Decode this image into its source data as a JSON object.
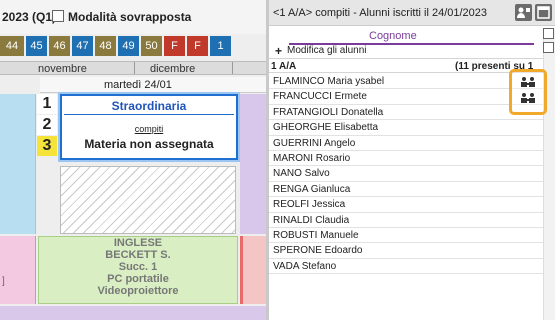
{
  "left": {
    "period_label": "2023 (Q1)",
    "toggle_label": "Modalità sovrapposta",
    "weeks": [
      {
        "label": "44",
        "bg": "#8b7a3e"
      },
      {
        "label": "45",
        "bg": "#1f6fb3"
      },
      {
        "label": "46",
        "bg": "#8b7a3e"
      },
      {
        "label": "47",
        "bg": "#1f6fb3"
      },
      {
        "label": "48",
        "bg": "#8b7a3e"
      },
      {
        "label": "49",
        "bg": "#1f6fb3"
      },
      {
        "label": "50",
        "bg": "#8b7a3e"
      },
      {
        "label": "F",
        "bg": "#c0392b"
      },
      {
        "label": "F",
        "bg": "#c0392b"
      },
      {
        "label": "1",
        "bg": "#1f6fb3"
      }
    ],
    "months": [
      "novembre",
      "dicembre"
    ],
    "day_header": "martedì 24/01",
    "hours": [
      "1",
      "2",
      "3"
    ],
    "card": {
      "title": "Straordinaria",
      "link": "compiti",
      "subtitle": "Materia non assegnata"
    },
    "pink_bracket": "]",
    "lesson": [
      "INGLESE",
      "BECKETT S.",
      "Succ. 1",
      "PC portatile",
      "Videoproiettore"
    ]
  },
  "right": {
    "title": "<1 A/A> compiti - Alunni iscritti il 24/01/2023",
    "column_header": "Cognome",
    "edit_label": "Modifica gli alunni",
    "group_label": "1 A/A",
    "group_count": "(11 presenti su 1",
    "students": [
      "FLAMINCO Maria ysabel",
      "FRANCUCCI Ermete",
      "FRATANGIOLI Donatella",
      "GHEORGHE Elisabetta",
      "GUERRINI Angelo",
      "MARONI Rosario",
      "NANO Salvo",
      "RENGA Gianluca",
      "REOLFI Jessica",
      "RINALDI Claudia",
      "ROBUSTI Manuele",
      "SPERONE Edoardo",
      "VADA Stefano"
    ]
  },
  "icons": {
    "highlight_color": "#f0a92a",
    "row_icon": "group-people-icon"
  }
}
